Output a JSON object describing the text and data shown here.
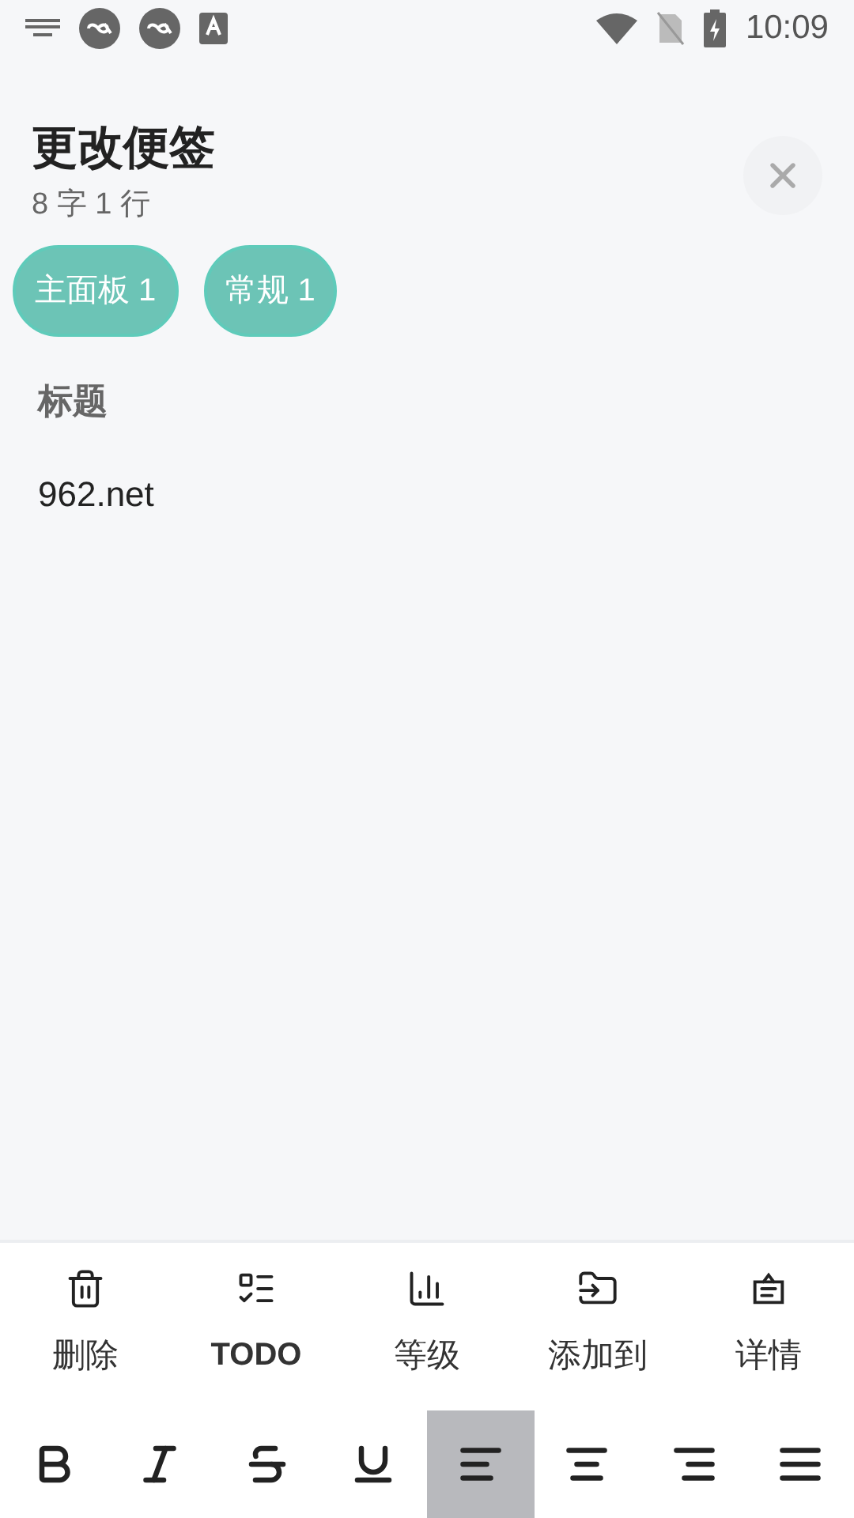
{
  "status_bar": {
    "time": "10:09"
  },
  "header": {
    "title": "更改便签",
    "stats": "8 字 1 行"
  },
  "tags": [
    {
      "label": "主面板 1"
    },
    {
      "label": "常规 1"
    }
  ],
  "note": {
    "title_placeholder": "标题",
    "body": "962.net"
  },
  "actions": [
    {
      "kind": "delete",
      "label": "删除"
    },
    {
      "kind": "todo",
      "label": "TODO"
    },
    {
      "kind": "level",
      "label": "等级"
    },
    {
      "kind": "move",
      "label": "添加到"
    },
    {
      "kind": "details",
      "label": "详情"
    }
  ],
  "format": [
    {
      "kind": "bold",
      "selected": false
    },
    {
      "kind": "italic",
      "selected": false
    },
    {
      "kind": "strike",
      "selected": false
    },
    {
      "kind": "underline",
      "selected": false
    },
    {
      "kind": "align-left",
      "selected": true
    },
    {
      "kind": "align-center",
      "selected": false
    },
    {
      "kind": "align-right",
      "selected": false
    },
    {
      "kind": "align-justify",
      "selected": false
    }
  ]
}
